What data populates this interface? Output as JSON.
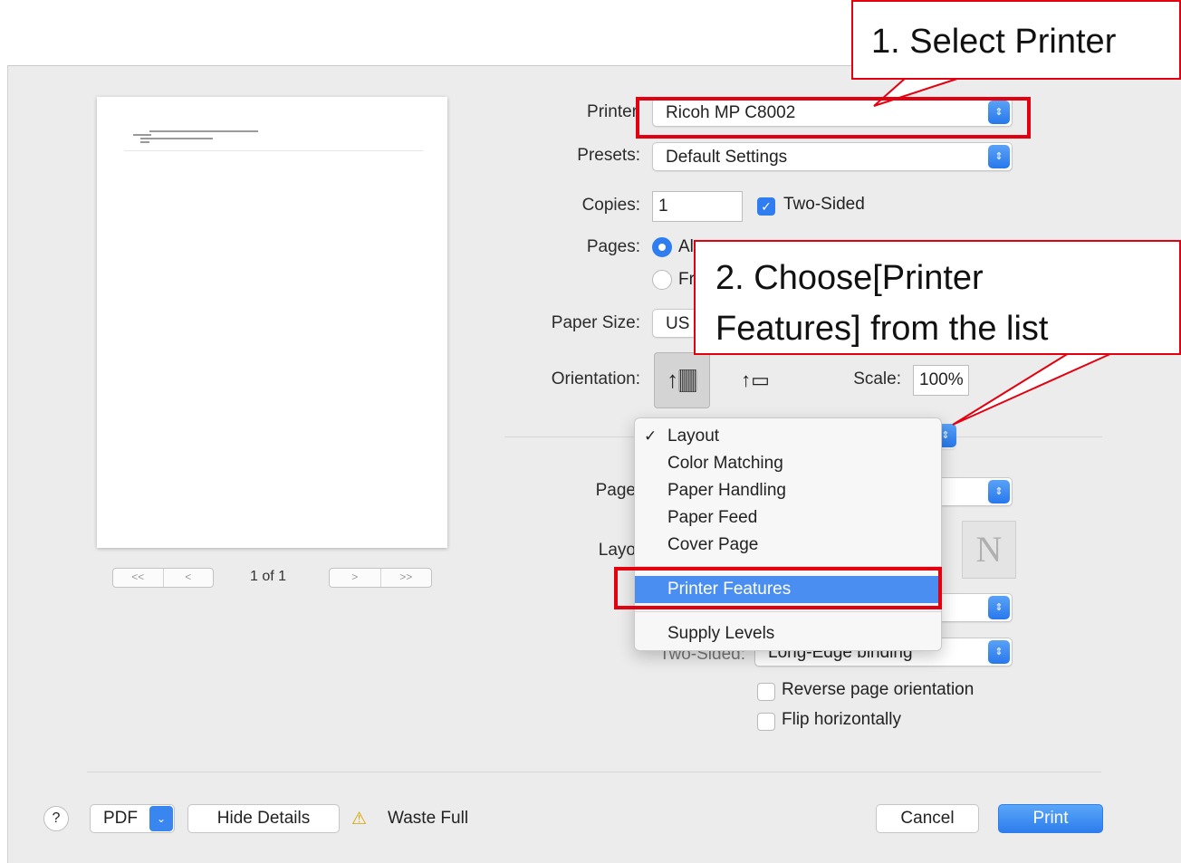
{
  "preview": {
    "page_counter": "1 of 1",
    "first_label": "<<",
    "prev_label": "<",
    "next_label": ">",
    "last_label": ">>"
  },
  "settings": {
    "printer_label": "Printer",
    "printer_value": "Ricoh MP C8002",
    "presets_label": "Presets:",
    "presets_value": "Default Settings",
    "copies_label": "Copies:",
    "copies_value": "1",
    "two_sided_label": "Two-Sided",
    "pages_label": "Pages:",
    "pages_all": "Al",
    "pages_from": "Fr",
    "paper_size_label": "Paper Size:",
    "paper_size_value": "US",
    "orientation_label": "Orientation:",
    "scale_label": "Scale:",
    "scale_value": "100%"
  },
  "lower": {
    "pages_per_sheet_label": "Page",
    "layout_direction_label": "Layo",
    "two_sided_label": "Two-Sided:",
    "two_sided_value": "Long-Edge binding",
    "reverse_label": "Reverse page orientation",
    "flip_label": "Flip horizontally"
  },
  "menu": {
    "items": [
      "Layout",
      "Color Matching",
      "Paper Handling",
      "Paper Feed",
      "Cover Page",
      "Printer Features",
      "Supply Levels"
    ],
    "checked": "Layout",
    "highlighted": "Printer Features"
  },
  "footer": {
    "help": "?",
    "pdf": "PDF",
    "hide_details": "Hide Details",
    "status": "Waste Full",
    "cancel": "Cancel",
    "print": "Print"
  },
  "annotations": {
    "step1": "1. Select Printer",
    "step2_line1": "2. Choose[Printer",
    "step2_line2": "Features] from the list"
  },
  "colors": {
    "accent": "#2f7df0",
    "annotation_red": "#e3000f",
    "menu_highlight": "#4a8ef1"
  }
}
